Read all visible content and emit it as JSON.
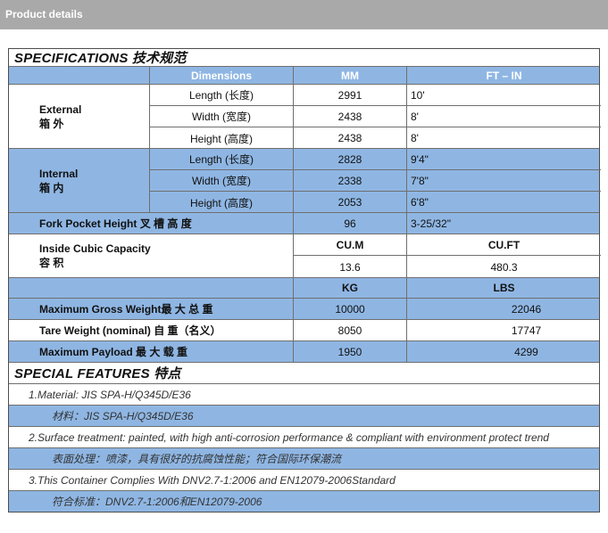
{
  "header": {
    "title": "Product details"
  },
  "specifications": {
    "title": "SPECIFICATIONS 技术规范",
    "columns": {
      "dimensions": "Dimensions",
      "mm": "MM",
      "ftin": "FT – IN"
    },
    "external": {
      "label_en": "External",
      "label_cn": "箱  外",
      "rows": [
        {
          "name": "Length (长度)",
          "mm": "2991",
          "ftin": "10'"
        },
        {
          "name": "Width (宽度)",
          "mm": "2438",
          "ftin": "8'"
        },
        {
          "name": "Height (高度)",
          "mm": "2438",
          "ftin": "8'"
        }
      ]
    },
    "internal": {
      "label_en": "Internal",
      "label_cn": "箱  内",
      "rows": [
        {
          "name": "Length (长度)",
          "mm": "2828",
          "ftin": "9'4\""
        },
        {
          "name": "Width (宽度)",
          "mm": "2338",
          "ftin": "7'8\""
        },
        {
          "name": "Height (高度)",
          "mm": "2053",
          "ftin": "6'8\""
        }
      ]
    },
    "fork_pocket": {
      "label": "Fork Pocket Height   叉 槽 高 度",
      "mm": "96",
      "ftin": "3-25/32\""
    },
    "cubic": {
      "label_en": "Inside Cubic Capacity",
      "label_cn": "容      积",
      "unit_m": "CU.M",
      "unit_ft": "CU.FT",
      "value_m": "13.6",
      "value_ft": "480.3"
    },
    "weight_units": {
      "kg": "KG",
      "lbs": "LBS"
    },
    "weights": [
      {
        "label": "Maximum Gross Weight最 大 总 重",
        "kg": "10000",
        "lbs": "22046"
      },
      {
        "label": "Tare Weight (nominal)  自 重（名义）",
        "kg": "8050",
        "lbs": "17747"
      },
      {
        "label": "Maximum Payload      最 大 载 重",
        "kg": "1950",
        "lbs": "4299"
      }
    ]
  },
  "features": {
    "title": "SPECIAL FEATURES 特点",
    "items": [
      "1.Material: JIS SPA-H/Q345D/E36",
      "材料：JIS SPA-H/Q345D/E36",
      "2.Surface treatment: painted, with high anti-corrosion performance & compliant with environment protect trend",
      "表面处理：喷漆，具有很好的抗腐蚀性能；符合国际环保潮流",
      "3.This Container Complies With DNV2.7-1:2006 and EN12079-2006Standard",
      "符合标准：DNV2.7-1:2006和EN12079-2006"
    ]
  }
}
